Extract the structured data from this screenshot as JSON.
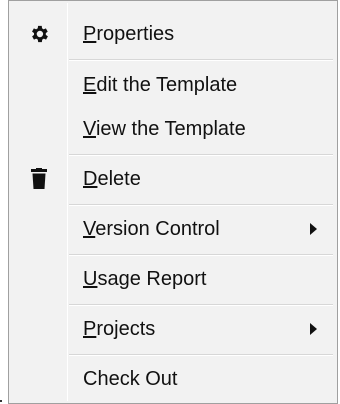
{
  "menu": {
    "items": [
      {
        "pre": "",
        "acc": "P",
        "post": "roperties",
        "icon": "gear-icon",
        "submenu": false
      },
      {
        "pre": "",
        "acc": "E",
        "post": "dit the Template",
        "icon": "",
        "submenu": false
      },
      {
        "pre": "",
        "acc": "V",
        "post": "iew the Template",
        "icon": "",
        "submenu": false
      },
      {
        "pre": "",
        "acc": "D",
        "post": "elete",
        "icon": "trash-icon",
        "submenu": false
      },
      {
        "pre": "",
        "acc": "V",
        "post": "ersion Control",
        "icon": "",
        "submenu": true
      },
      {
        "pre": "",
        "acc": "U",
        "post": "sage Report",
        "icon": "",
        "submenu": false
      },
      {
        "pre": "",
        "acc": "P",
        "post": "rojects",
        "icon": "",
        "submenu": true
      },
      {
        "pre": "Check Out",
        "acc": "",
        "post": "",
        "icon": "",
        "submenu": false
      }
    ]
  },
  "colors": {
    "menu_background": "#f2f2f2",
    "menu_border": "#a0a0a0",
    "text": "#111111"
  }
}
